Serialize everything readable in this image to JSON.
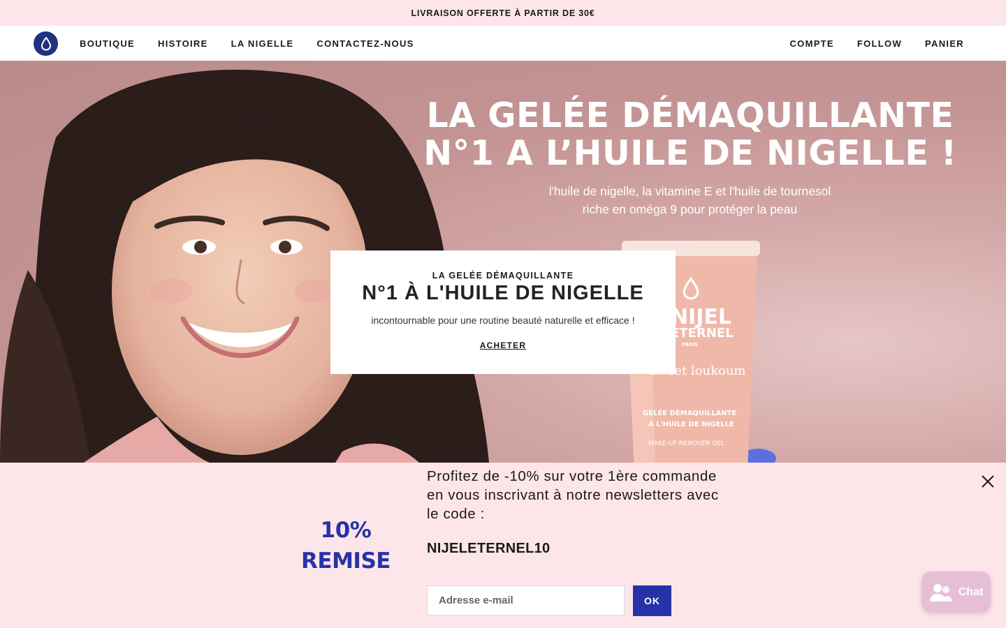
{
  "announcement": "LIVRAISON OFFERTE À PARTIR DE 30€",
  "nav": {
    "left": [
      "BOUTIQUE",
      "HISTOIRE",
      "LA NIGELLE",
      "CONTACTEZ-NOUS"
    ],
    "right": [
      "COMPTE",
      "FOLLOW",
      "PANIER"
    ]
  },
  "hero": {
    "heading_line1": "LA GELÉE DÉMAQUILLANTE",
    "heading_line2": "N°1 A L’HUILE DE NIGELLE !",
    "sub_line1": "l'huile de nigelle, la vitamine E et l'huile de tournesol",
    "sub_line2": "riche en oméga 9 pour protéger la peau",
    "tube": {
      "brand_line1": "NIJEL",
      "brand_line2": "ETERNEL",
      "brand_city": "PARIS",
      "scent": "sweet loukoum",
      "product_line1": "GELÉE DÉMAQUILLANTE",
      "product_line2": "À L'HUILE DE NIGELLE",
      "product_en": "MAKE-UP REMOVER GEL"
    }
  },
  "card": {
    "eyebrow": "LA GELÉE DÉMAQUILLANTE",
    "title": "N°1 À L'HUILE DE NIGELLE",
    "text": "incontournable pour une routine beauté naturelle et efficace !",
    "cta": "ACHETER"
  },
  "newsletter": {
    "badge_line1": "10%",
    "badge_line2": "REMISE",
    "text": "Profitez de -10% sur votre 1ère commande en vous inscrivant à notre newsletters avec le code :",
    "code": "NIJELETERNEL10",
    "email_placeholder": "Adresse e-mail",
    "submit": "OK"
  },
  "chat": {
    "label": "Chat"
  },
  "colors": {
    "accent": "#2832a8",
    "logo": "#22327f",
    "pink_bg": "#fde6ea",
    "chat": "#e6bfd6"
  },
  "icons": [
    "water-drop-icon",
    "close-icon",
    "chat-people-icon"
  ]
}
